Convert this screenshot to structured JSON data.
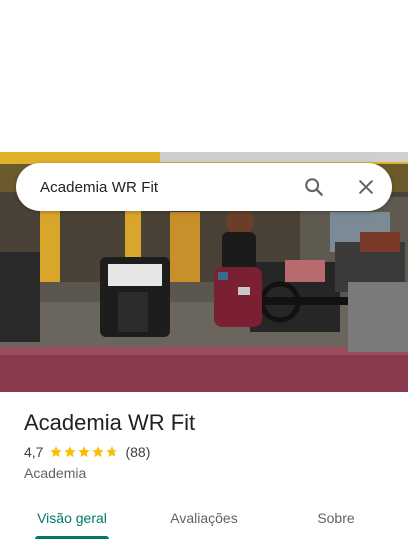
{
  "search": {
    "query": "Academia WR Fit"
  },
  "icons": {
    "search": "search-icon",
    "close": "close-icon"
  },
  "place": {
    "name": "Academia WR Fit",
    "rating": "4,7",
    "rating_numeric": 4.7,
    "review_count": "(88)",
    "category": "Academia"
  },
  "tabs": [
    {
      "label": "Visão geral",
      "active": true
    },
    {
      "label": "Avaliações",
      "active": false
    },
    {
      "label": "Sobre",
      "active": false
    }
  ],
  "colors": {
    "accent": "#00796b",
    "star": "#fbbc04",
    "star_empty": "#dadce0"
  }
}
